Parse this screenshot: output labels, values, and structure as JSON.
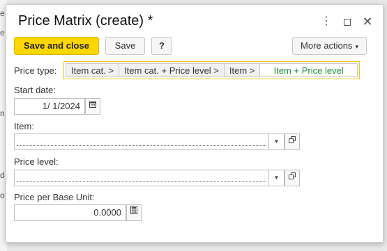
{
  "background": {
    "fragments": [
      "e",
      "e",
      "n",
      "d",
      "o"
    ]
  },
  "dialog": {
    "title": "Price Matrix (create) *",
    "window_controls": {
      "more": "⋮",
      "maximize": "",
      "close": "✕"
    }
  },
  "toolbar": {
    "save_and_close": "Save and close",
    "save": "Save",
    "help": "?",
    "more_actions": "More actions",
    "more_caret": "▾"
  },
  "form": {
    "price_type": {
      "label": "Price type:",
      "options": [
        "Item cat. >",
        "Item cat. + Price level >",
        "Item >",
        "Item + Price level"
      ],
      "selected": "Item + Price level"
    },
    "start_date": {
      "label": "Start date:",
      "value": "1/ 1/2024"
    },
    "item": {
      "label": "Item:",
      "value": ""
    },
    "price_level": {
      "label": "Price level:",
      "value": ""
    },
    "price_per_base_unit": {
      "label": "Price per Base Unit:",
      "value": "0.0000"
    }
  },
  "icons": {
    "calendar": "calendar-icon",
    "dropdown": "chevron-down-icon",
    "open": "open-in-window-icon",
    "calculator": "calculator-icon"
  },
  "colors": {
    "primary_button": "#ffd700",
    "selected_option_text": "#1b8c3a",
    "group_border": "#f0c419"
  }
}
